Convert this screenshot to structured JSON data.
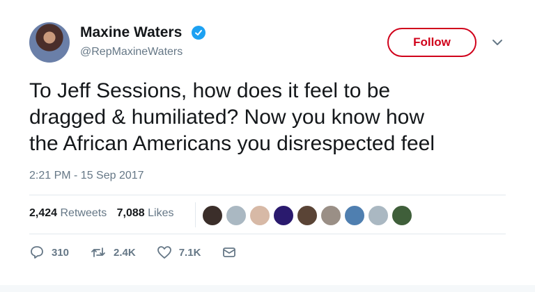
{
  "user": {
    "display_name": "Maxine Waters",
    "handle": "@RepMaxineWaters"
  },
  "follow_button": {
    "label": "Follow"
  },
  "tweet": {
    "text_lines": [
      "To Jeff Sessions, how does it feel to be",
      "dragged & humiliated? Now you know how",
      "the African Americans you disrespected feel"
    ],
    "timestamp": "2:21 PM - 15 Sep 2017"
  },
  "stats": {
    "retweets_count": "2,424",
    "retweets_label": "Retweets",
    "likes_count": "7,088",
    "likes_label": "Likes"
  },
  "likers": [
    {
      "color": "#3b2e2a"
    },
    {
      "color": "#aab8c2"
    },
    {
      "color": "#d7b9a6"
    },
    {
      "color": "#2a1a6e"
    },
    {
      "color": "#5a4436"
    },
    {
      "color": "#9a8f86"
    },
    {
      "color": "#4f7fb0"
    },
    {
      "color": "#aab8c2"
    },
    {
      "color": "#3f5f3a"
    }
  ],
  "actions": {
    "replies": "310",
    "retweets": "2.4K",
    "likes": "7.1K"
  },
  "colors": {
    "follow_red": "#d0021b",
    "verified_blue": "#1da1f2",
    "secondary_text": "#657786"
  }
}
